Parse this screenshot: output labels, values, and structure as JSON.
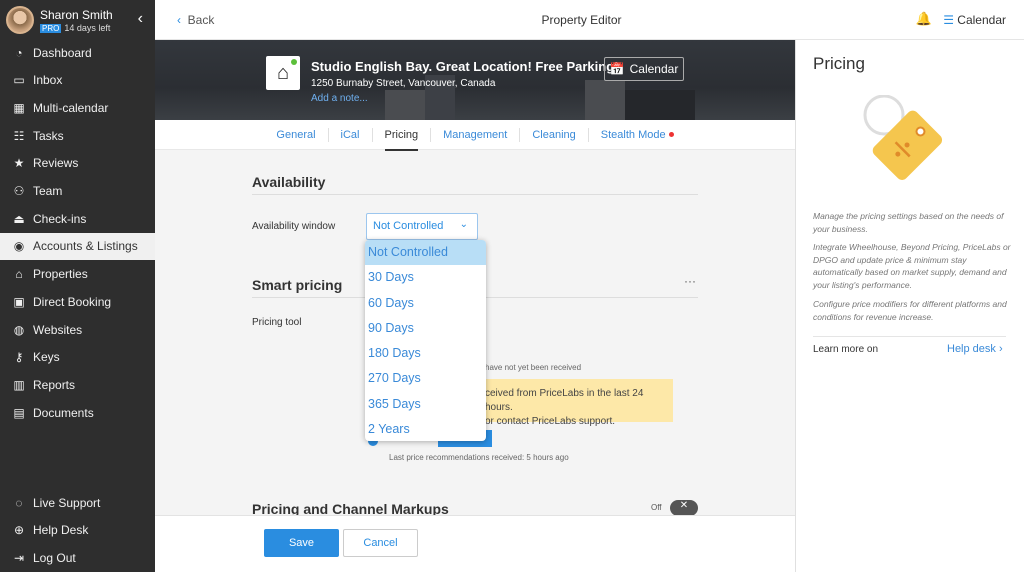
{
  "user": {
    "name": "Sharon Smith",
    "badge": "PRO",
    "trial": "14 days left"
  },
  "sidebar": {
    "items": [
      {
        "label": "Dashboard",
        "icon": "speedometer-icon"
      },
      {
        "label": "Inbox",
        "icon": "inbox-icon"
      },
      {
        "label": "Multi-calendar",
        "icon": "calendar-icon"
      },
      {
        "label": "Tasks",
        "icon": "tasks-icon"
      },
      {
        "label": "Reviews",
        "icon": "star-icon"
      },
      {
        "label": "Team",
        "icon": "team-icon"
      },
      {
        "label": "Check-ins",
        "icon": "bell-service-icon"
      },
      {
        "label": "Accounts & Listings",
        "icon": "user-circle-icon",
        "active": true
      },
      {
        "label": "Properties",
        "icon": "home-icon"
      },
      {
        "label": "Direct Booking",
        "icon": "code-window-icon"
      },
      {
        "label": "Websites",
        "icon": "globe-icon"
      },
      {
        "label": "Keys",
        "icon": "key-icon"
      },
      {
        "label": "Reports",
        "icon": "bar-chart-icon"
      },
      {
        "label": "Documents",
        "icon": "document-icon"
      }
    ],
    "bottom": [
      {
        "label": "Live Support",
        "icon": "chat-icon"
      },
      {
        "label": "Help Desk",
        "icon": "lifebuoy-icon"
      },
      {
        "label": "Log Out",
        "icon": "logout-icon"
      }
    ]
  },
  "topbar": {
    "back": "Back",
    "title": "Property Editor",
    "calendar": "Calendar"
  },
  "listing": {
    "title": "Studio English Bay. Great Location! Free Parking!",
    "address": "1250 Burnaby Street, Vancouver, Canada",
    "note": "Add a note...",
    "calendar": "Calendar"
  },
  "tabs": [
    {
      "label": "General"
    },
    {
      "label": "iCal"
    },
    {
      "label": "Pricing",
      "active": true
    },
    {
      "label": "Management"
    },
    {
      "label": "Cleaning"
    },
    {
      "label": "Stealth Mode",
      "dot": true
    }
  ],
  "availability": {
    "heading": "Availability",
    "label": "Availability window",
    "value": "Not Controlled",
    "options": [
      "Not Controlled",
      "30 Days",
      "60 Days",
      "90 Days",
      "180 Days",
      "270 Days",
      "365 Days",
      "2 Years"
    ]
  },
  "smart_pricing": {
    "heading": "Smart pricing",
    "label": "Pricing tool",
    "note1": "have not yet been received",
    "warning_line1": "ceived from PriceLabs in the last 24 hours.",
    "warning_line2": "or contact PriceLabs support.",
    "last_received": "Last price recommendations received: 5 hours ago"
  },
  "markups": {
    "heading": "Pricing and Channel Markups",
    "toggle_label": "Off"
  },
  "footer": {
    "save": "Save",
    "cancel": "Cancel"
  },
  "right_panel": {
    "title": "Pricing",
    "p1": "Manage the pricing settings based on the needs of your business.",
    "p2": "Integrate Wheelhouse, Beyond Pricing, PriceLabs or DPGO and update price & minimum stay automatically based on market supply, demand and your listing's performance.",
    "p3": "Configure price modifiers for different platforms and conditions for revenue increase.",
    "learn": "Learn more on",
    "link": "Help desk"
  },
  "colors": {
    "accent": "#2a8de0",
    "sidebar": "#2e2e2e",
    "warning": "#fde8a8"
  }
}
